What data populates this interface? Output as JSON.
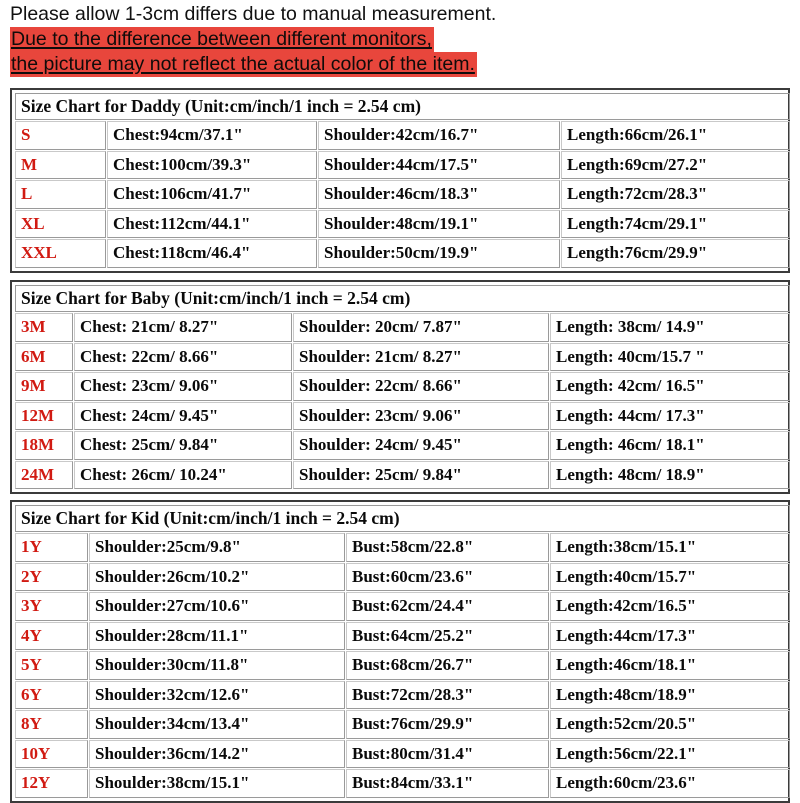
{
  "notice": {
    "line1": "Please allow 1-3cm differs due to manual measurement.",
    "line2": "Due to the difference between different monitors,",
    "line3": "the picture may not reflect the actual color of the item.",
    "highlight_color": "#e8463c"
  },
  "colors": {
    "size_label": "#d11a12",
    "text": "#0a0a0a",
    "table_border": "#3b3b3b",
    "cell_border": "#9a9a9a"
  },
  "tables": [
    {
      "id": "daddy",
      "title": "Size Chart for Daddy (Unit:cm/inch/1 inch = 2.54 cm)",
      "rows": [
        {
          "size": "S",
          "c1": "Chest:94cm/37.1\"",
          "c2": "Shoulder:42cm/16.7\"",
          "c3": "Length:66cm/26.1\""
        },
        {
          "size": "M",
          "c1": "Chest:100cm/39.3\"",
          "c2": "Shoulder:44cm/17.5\"",
          "c3": "Length:69cm/27.2\""
        },
        {
          "size": "L",
          "c1": "Chest:106cm/41.7\"",
          "c2": "Shoulder:46cm/18.3\"",
          "c3": "Length:72cm/28.3\""
        },
        {
          "size": "XL",
          "c1": "Chest:112cm/44.1\"",
          "c2": "Shoulder:48cm/19.1\"",
          "c3": "Length:74cm/29.1\""
        },
        {
          "size": "XXL",
          "c1": "Chest:118cm/46.4\"",
          "c2": "Shoulder:50cm/19.9\"",
          "c3": "Length:76cm/29.9\""
        }
      ]
    },
    {
      "id": "baby",
      "title": "Size Chart for Baby (Unit:cm/inch/1 inch = 2.54 cm)",
      "rows": [
        {
          "size": "3M",
          "c1": "Chest: 21cm/ 8.27\"",
          "c2": "Shoulder: 20cm/ 7.87\"",
          "c3": "Length:  38cm/ 14.9\""
        },
        {
          "size": "6M",
          "c1": "Chest: 22cm/ 8.66\"",
          "c2": "Shoulder: 21cm/ 8.27\"",
          "c3": "Length:  40cm/15.7 \""
        },
        {
          "size": "9M",
          "c1": "Chest: 23cm/ 9.06\"",
          "c2": "Shoulder: 22cm/ 8.66\"",
          "c3": "Length: 42cm/ 16.5\""
        },
        {
          "size": "12M",
          "c1": "Chest: 24cm/ 9.45\"",
          "c2": "Shoulder: 23cm/ 9.06\"",
          "c3": "Length: 44cm/ 17.3\""
        },
        {
          "size": "18M",
          "c1": "Chest: 25cm/ 9.84\"",
          "c2": "Shoulder: 24cm/ 9.45\"",
          "c3": "Length: 46cm/ 18.1\""
        },
        {
          "size": "24M",
          "c1": "Chest: 26cm/ 10.24\"",
          "c2": "Shoulder: 25cm/ 9.84\"",
          "c3": "Length: 48cm/ 18.9\""
        }
      ]
    },
    {
      "id": "kid",
      "title": "Size Chart for Kid (Unit:cm/inch/1 inch = 2.54 cm)",
      "rows": [
        {
          "size": "1Y",
          "c1": "Shoulder:25cm/9.8\"",
          "c2": "Bust:58cm/22.8\"",
          "c3": "Length:38cm/15.1\""
        },
        {
          "size": "2Y",
          "c1": "Shoulder:26cm/10.2\"",
          "c2": "Bust:60cm/23.6\"",
          "c3": "Length:40cm/15.7\""
        },
        {
          "size": "3Y",
          "c1": "Shoulder:27cm/10.6\"",
          "c2": "Bust:62cm/24.4\"",
          "c3": "Length:42cm/16.5\""
        },
        {
          "size": "4Y",
          "c1": "Shoulder:28cm/11.1\"",
          "c2": "Bust:64cm/25.2\"",
          "c3": "Length:44cm/17.3\""
        },
        {
          "size": "5Y",
          "c1": "Shoulder:30cm/11.8\"",
          "c2": "Bust:68cm/26.7\"",
          "c3": "Length:46cm/18.1\""
        },
        {
          "size": "6Y",
          "c1": "Shoulder:32cm/12.6\"",
          "c2": "Bust:72cm/28.3\"",
          "c3": "Length:48cm/18.9\""
        },
        {
          "size": "8Y",
          "c1": "Shoulder:34cm/13.4\"",
          "c2": "Bust:76cm/29.9\"",
          "c3": "Length:52cm/20.5\""
        },
        {
          "size": "10Y",
          "c1": "Shoulder:36cm/14.2\"",
          "c2": "Bust:80cm/31.4\"",
          "c3": "Length:56cm/22.1\""
        },
        {
          "size": "12Y",
          "c1": "Shoulder:38cm/15.1\"",
          "c2": "Bust:84cm/33.1\"",
          "c3": "Length:60cm/23.6\""
        }
      ]
    }
  ]
}
